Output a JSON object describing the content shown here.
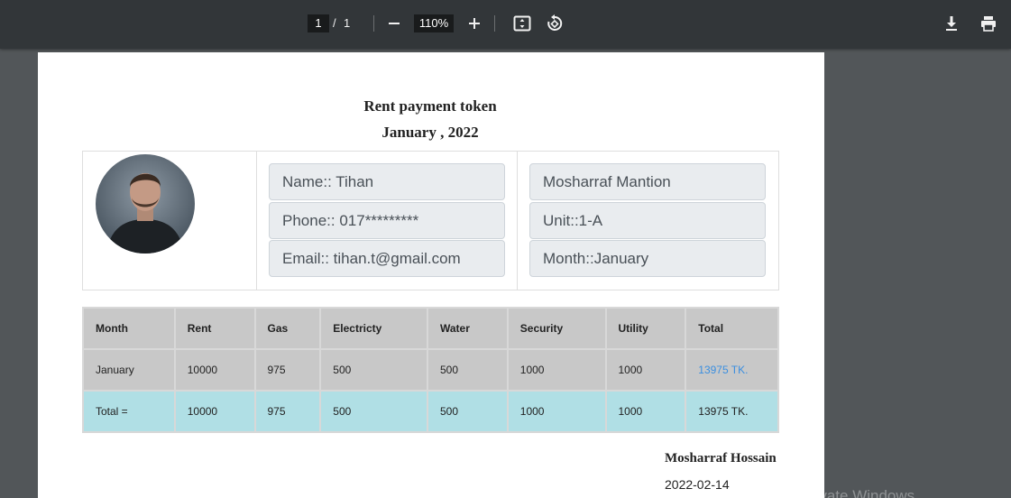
{
  "toolbar": {
    "current_page": "1",
    "page_separator": "/",
    "total_pages": "1",
    "zoom": "110%",
    "icons": [
      "minus-icon",
      "plus-icon",
      "fit-page-icon",
      "rotate-icon",
      "download-icon",
      "print-icon"
    ]
  },
  "document": {
    "title": "Rent payment token",
    "period": "January , 2022",
    "tenant": {
      "name": "Name:: Tihan",
      "phone": "Phone:: 017*********",
      "email": "Email:: tihan.t@gmail.com"
    },
    "property": {
      "building": "Mosharraf Mantion",
      "unit": "Unit::1-A",
      "month": "Month::January"
    },
    "table": {
      "headers": [
        "Month",
        "Rent",
        "Gas",
        "Electricty",
        "Water",
        "Security",
        "Utility",
        "Total"
      ],
      "rows": [
        [
          "January",
          "10000",
          "975",
          "500",
          "500",
          "1000",
          "1000",
          "13975 TK."
        ]
      ],
      "total_row": [
        "Total =",
        "10000",
        "975",
        "500",
        "500",
        "1000",
        "1000",
        "13975 TK."
      ]
    },
    "signature": {
      "name": "Mosharraf Hossain",
      "date": "2022-02-14"
    }
  },
  "overlay": {
    "watermark": "Activate Windows"
  },
  "colors": {
    "toolbar_bg": "#323639",
    "viewer_bg": "#525659",
    "link": "#3b8fe0",
    "total_row": "#b0dfe5"
  }
}
